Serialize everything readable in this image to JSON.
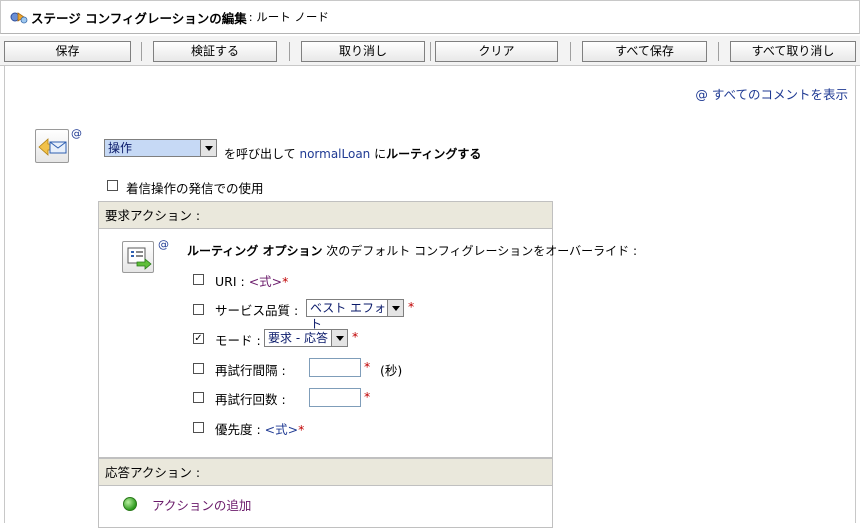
{
  "title": {
    "main": "ステージ コンフィグレーションの編集",
    "sub": ": ルート ノード"
  },
  "toolbar": {
    "save": "保存",
    "validate": "検証する",
    "cancel": "取り消し",
    "clear": "クリア",
    "save_all": "すべて保存",
    "cancel_all": "すべて取り消し"
  },
  "comments_link": "すべてのコメントを表示",
  "at_symbol": "@",
  "route": {
    "operation_select": "操作",
    "text_pre": "を呼び出して",
    "service": "normalLoan",
    "text_ni": "に",
    "text_routing": "ルーティングする"
  },
  "inbound_checkbox": {
    "label": "着信操作の発信での使用",
    "checked": false
  },
  "request_panel": {
    "header": "要求アクション :",
    "routing_options_bold": "ルーティング オプション",
    "routing_options_rest": "次のデフォルト コンフィグレーションをオーバーライド :",
    "uri": {
      "label": "URI :",
      "expr": "<式>",
      "checked": false
    },
    "qos": {
      "label": "サービス品質 :",
      "value": "ベスト エフォート",
      "checked": false
    },
    "mode": {
      "label": "モード :",
      "value": "要求 - 応答",
      "checked": true
    },
    "retry_interval": {
      "label": "再試行間隔 :",
      "unit": "(秒)",
      "value": "",
      "checked": false
    },
    "retry_count": {
      "label": "再試行回数 :",
      "value": "",
      "checked": false
    },
    "priority": {
      "label": "優先度 :",
      "expr": "<式>",
      "checked": false
    },
    "required_mark": "*",
    "checkmark": "✓"
  },
  "response_panel": {
    "header": "応答アクション :",
    "add_action": "アクションの追加"
  }
}
